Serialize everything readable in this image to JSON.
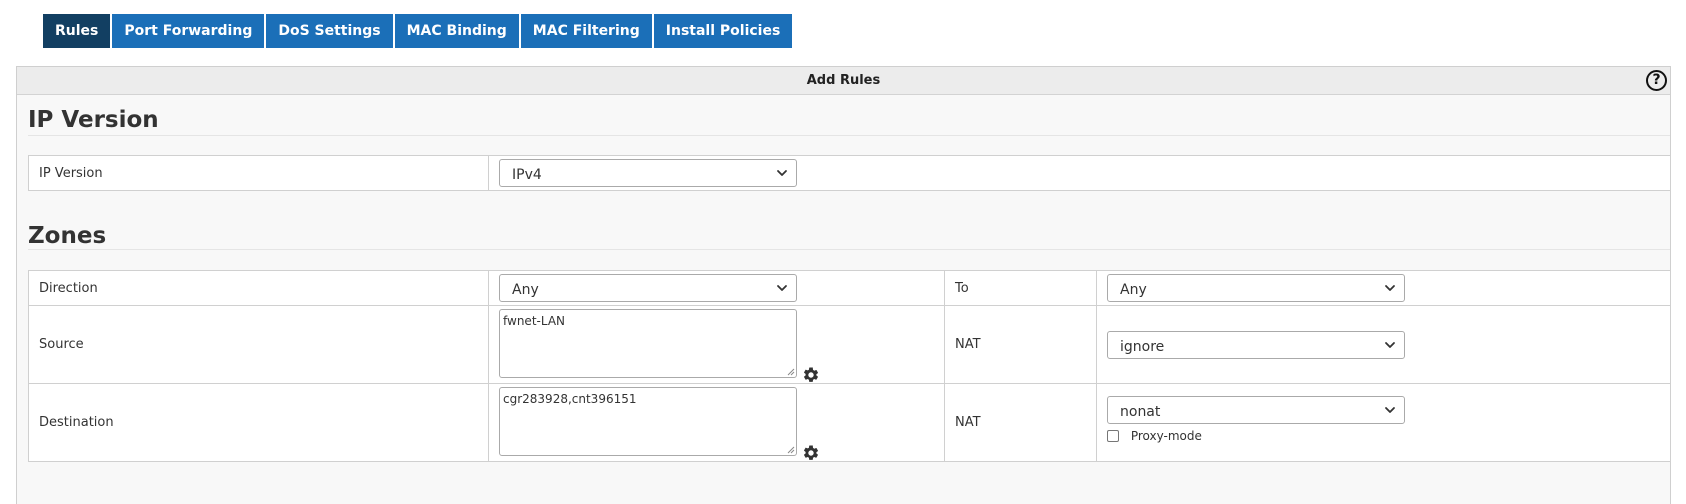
{
  "tabs": [
    {
      "label": "Rules",
      "active": true
    },
    {
      "label": "Port Forwarding",
      "active": false
    },
    {
      "label": "DoS Settings",
      "active": false
    },
    {
      "label": "MAC Binding",
      "active": false
    },
    {
      "label": "MAC Filtering",
      "active": false
    },
    {
      "label": "Install Policies",
      "active": false
    }
  ],
  "panel": {
    "title": "Add Rules",
    "help_icon": "question-circle-icon",
    "help_glyph": "?"
  },
  "ip_version_section": {
    "title": "IP Version",
    "row": {
      "label": "IP Version",
      "value": "IPv4"
    }
  },
  "zones_section": {
    "title": "Zones",
    "direction": {
      "label": "Direction",
      "value": "Any",
      "to_label": "To",
      "to_value": "Any"
    },
    "source": {
      "label": "Source",
      "value": "fwnet-LAN",
      "nat_label": "NAT",
      "nat_value": "ignore"
    },
    "destination": {
      "label": "Destination",
      "value": "cgr283928,cnt396151",
      "nat_label": "NAT",
      "nat_value": "nonat",
      "proxy_label": "Proxy-mode",
      "proxy_checked": false
    }
  },
  "colors": {
    "tab_bg": "#1b6fb8",
    "tab_active_bg": "#123f62",
    "panel_bg": "#f8f8f8",
    "header_bg": "#ececec"
  }
}
